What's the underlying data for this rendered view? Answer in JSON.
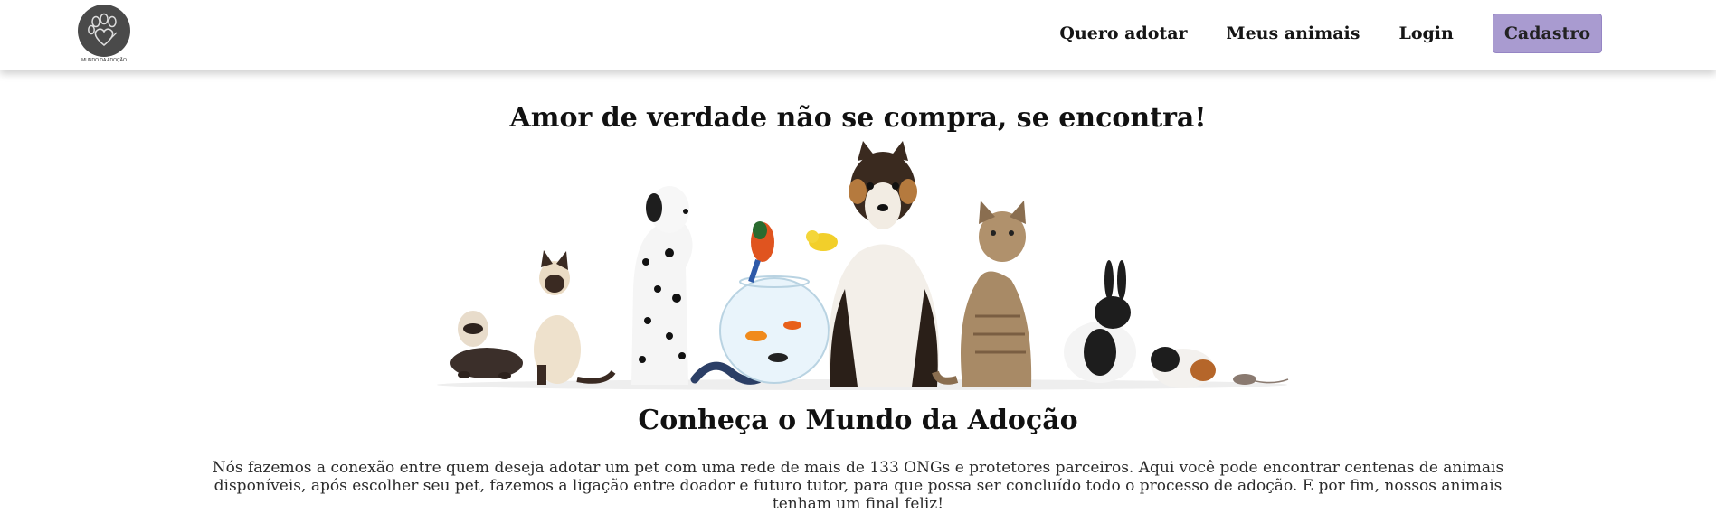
{
  "brand": {
    "logo_text": "MUNDO DA ADOÇÃO",
    "logo_icon": "paw-heart-icon",
    "logo_color": "#4a4a4a"
  },
  "nav": {
    "links": [
      {
        "label": "Quero adotar"
      },
      {
        "label": "Meus animais"
      },
      {
        "label": "Login"
      }
    ],
    "cta_label": "Cadastro",
    "cta_color": "#a99bd0"
  },
  "hero": {
    "title": "Amor de verdade não se compra, se encontra!",
    "image_icon": "pets-group-illustration"
  },
  "about": {
    "title": "Conheça o Mundo da Adoção",
    "text": "Nós fazemos a conexão entre quem deseja adotar um pet com uma rede de mais de 133 ONGs e protetores parceiros. Aqui você pode encontrar centenas de animais disponíveis, após escolher seu pet, fazemos a ligação entre doador e futuro tutor, para que possa ser concluído todo o processo de adoção. E por fim, nossos animais tenham um final feliz!"
  }
}
